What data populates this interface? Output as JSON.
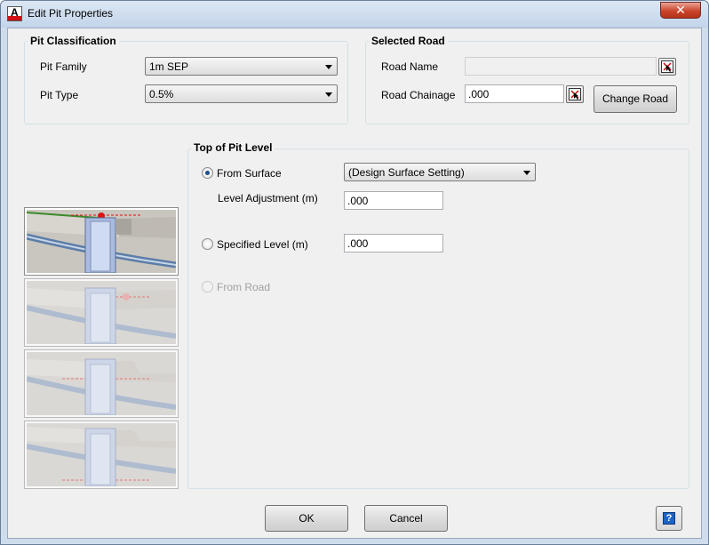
{
  "window": {
    "title": "Edit Pit Properties",
    "close_label": "✕"
  },
  "pit_classification": {
    "title": "Pit Classification",
    "family_label": "Pit Family",
    "family_value": "1m SEP",
    "type_label": "Pit Type",
    "type_value": "0.5%"
  },
  "selected_road": {
    "title": "Selected Road",
    "name_label": "Road Name",
    "name_value": "",
    "chainage_label": "Road Chainage",
    "chainage_value": ".000",
    "change_road_label": "Change Road"
  },
  "top_of_pit": {
    "title": "Top of Pit Level",
    "from_surface_label": "From Surface",
    "surface_value": "(Design Surface Setting)",
    "level_adjustment_label": "Level Adjustment (m)",
    "level_adjustment_value": ".000",
    "specified_level_label": "Specified Level (m)",
    "specified_level_value": ".000",
    "from_road_label": "From Road",
    "selected_option": "From Surface"
  },
  "footer": {
    "ok_label": "OK",
    "cancel_label": "Cancel",
    "help_label": "?"
  },
  "colors": {
    "accent_red": "#e01010",
    "title_bar": "#c3d4ea",
    "radio_dot": "#1c4f8f"
  }
}
